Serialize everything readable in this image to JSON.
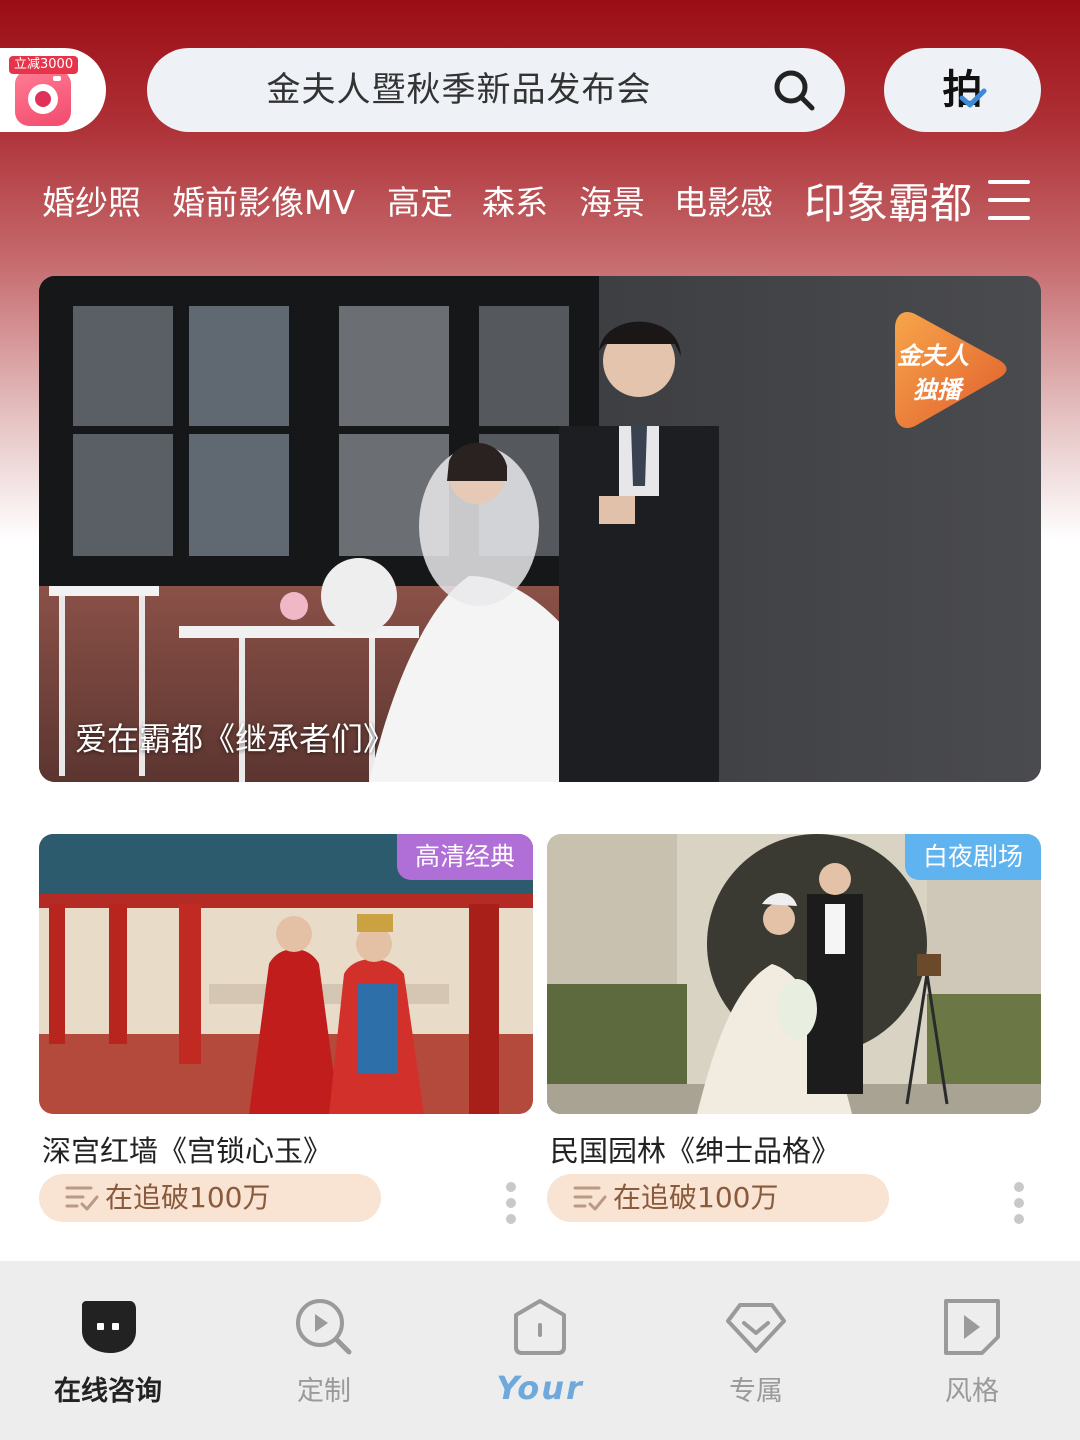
{
  "header": {
    "promo_badge": "立减3000",
    "search_text": "金夫人暨秋季新品发布会",
    "shoot_button": "拍"
  },
  "categories": [
    "婚纱照",
    "婚前影像MV",
    "高定",
    "森系",
    "海景",
    "电影感",
    "印象霸都"
  ],
  "hero": {
    "title": "爱在霸都《继承者们》",
    "badge_line1": "金夫人",
    "badge_line2": "独播"
  },
  "cards": [
    {
      "title": "深宫红墙《宫锁心玉》",
      "tag": "高清经典",
      "tag_color": "#b06fd6",
      "stat": "在追破100万"
    },
    {
      "title": "民国园林《绅士品格》",
      "tag": "白夜剧场",
      "tag_color": "#5fb3ee",
      "stat": "在追破100万"
    }
  ],
  "tabbar": [
    {
      "label": "在线咨询",
      "icon": "chat-icon"
    },
    {
      "label": "定制",
      "icon": "search-play-icon"
    },
    {
      "label": "Your",
      "icon": "home-icon"
    },
    {
      "label": "专属",
      "icon": "diamond-icon"
    },
    {
      "label": "风格",
      "icon": "play-icon"
    }
  ],
  "colors": {
    "header_red": "#9b0d14",
    "your_blue": "#6fa9dc",
    "pill_bg": "#f9e3d3"
  }
}
